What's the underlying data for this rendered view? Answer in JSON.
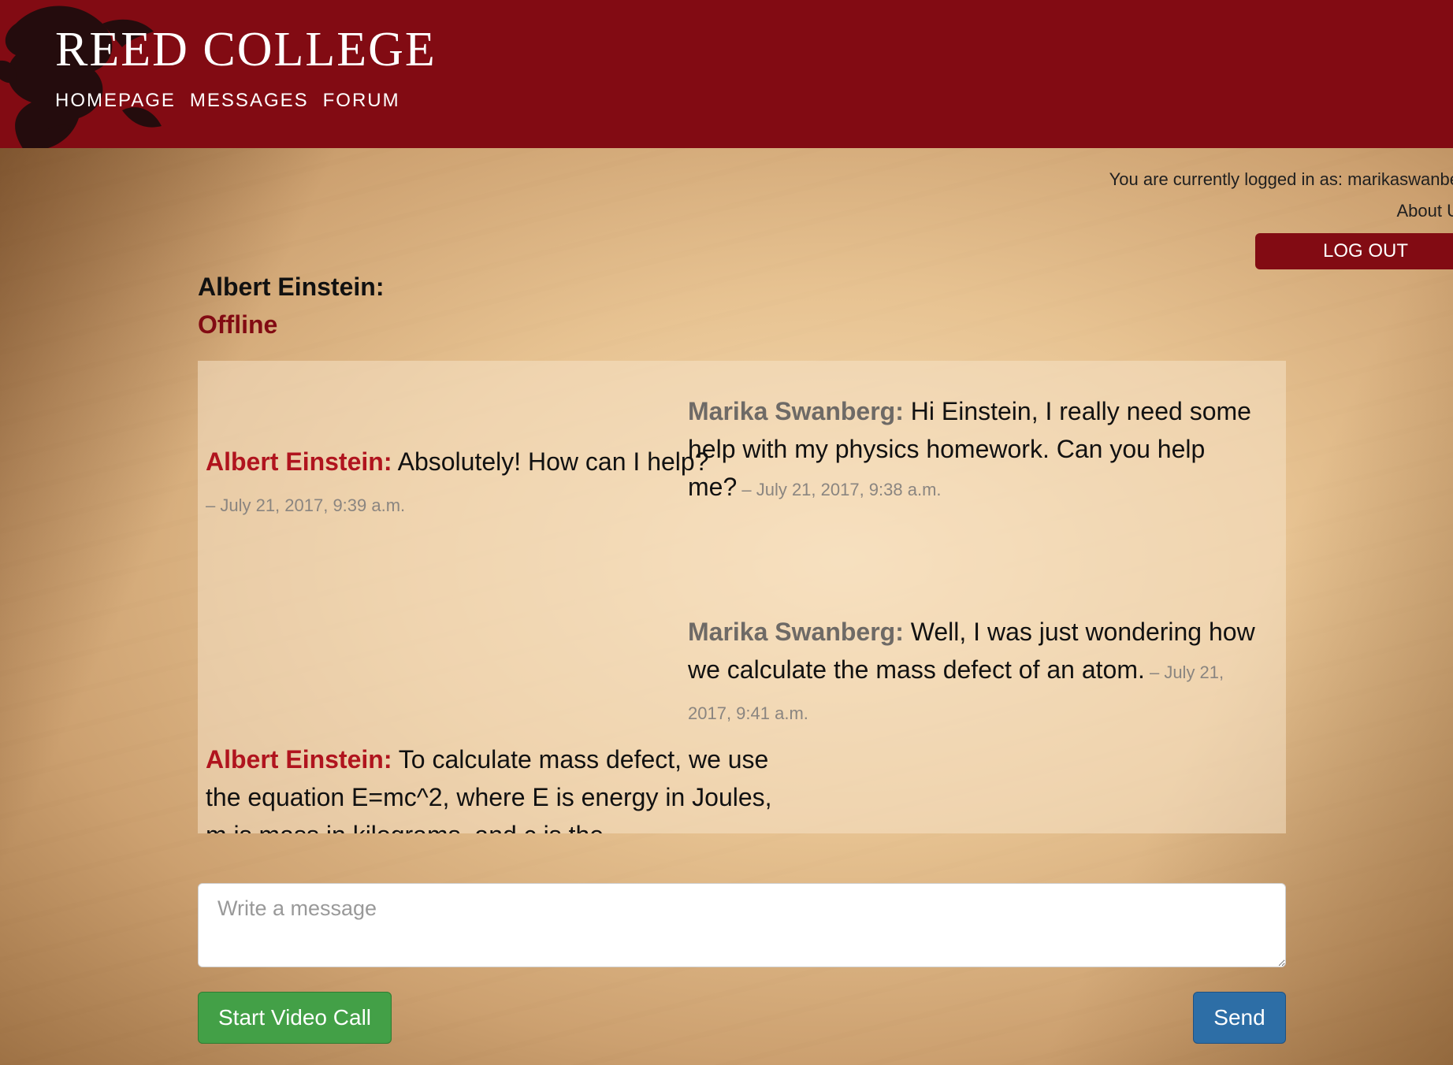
{
  "header": {
    "brand": "REED COLLEGE",
    "nav": [
      "HOMEPAGE",
      "MESSAGES",
      "FORUM"
    ]
  },
  "account": {
    "logged_in_text": "You are currently logged in as: marikaswanbe",
    "about_link": "About U",
    "logout_label": "LOG OUT"
  },
  "contact": {
    "name": "Albert Einstein:",
    "status": "Offline"
  },
  "messages": [
    {
      "sender": "Marika Swanberg:",
      "text": " Hi Einstein, I really need some help with my physics homework. Can you help me?",
      "timestamp": " – July 21, 2017, 9:38 a.m.",
      "side": "mine"
    },
    {
      "sender": "Albert Einstein:",
      "text": " Absolutely! How can I help?",
      "timestamp": " – July 21, 2017, 9:39 a.m.",
      "side": "theirs"
    },
    {
      "sender": "Marika Swanberg:",
      "text": " Well, I was just wondering how we calculate the mass defect of an atom.",
      "timestamp": " – July 21, 2017, 9:41 a.m.",
      "side": "mine"
    },
    {
      "sender": "Albert Einstein:",
      "text": " To calculate mass defect, we use the equation E=mc^2, where E is energy in Joules, m is mass in kilograms, and c is the",
      "timestamp": "",
      "side": "theirs"
    }
  ],
  "composer": {
    "placeholder": "Write a message"
  },
  "buttons": {
    "video_call": "Start Video Call",
    "send": "Send"
  },
  "colors": {
    "brand_red": "#820b13",
    "sender_theirs": "#b0141e",
    "video_green": "#43a047",
    "send_blue": "#2d6ea6"
  }
}
